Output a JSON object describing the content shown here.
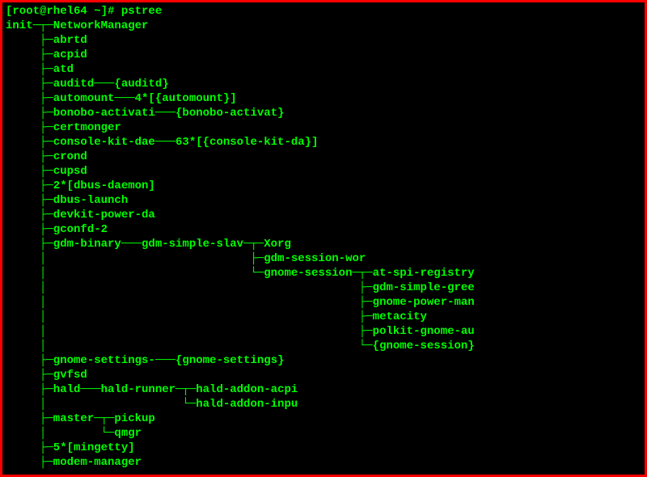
{
  "prompt": "[root@rhel64 ~]# ",
  "command": "pstree",
  "tree": [
    "init─┬─NetworkManager",
    "     ├─abrtd",
    "     ├─acpid",
    "     ├─atd",
    "     ├─auditd───{auditd}",
    "     ├─automount───4*[{automount}]",
    "     ├─bonobo-activati───{bonobo-activat}",
    "     ├─certmonger",
    "     ├─console-kit-dae───63*[{console-kit-da}]",
    "     ├─crond",
    "     ├─cupsd",
    "     ├─2*[dbus-daemon]",
    "     ├─dbus-launch",
    "     ├─devkit-power-da",
    "     ├─gconfd-2",
    "     ├─gdm-binary───gdm-simple-slav─┬─Xorg",
    "     │                              ├─gdm-session-wor",
    "     │                              └─gnome-session─┬─at-spi-registry",
    "     │                                              ├─gdm-simple-gree",
    "     │                                              ├─gnome-power-man",
    "     │                                              ├─metacity",
    "     │                                              ├─polkit-gnome-au",
    "     │                                              └─{gnome-session}",
    "     ├─gnome-settings-───{gnome-settings}",
    "     ├─gvfsd",
    "     ├─hald───hald-runner─┬─hald-addon-acpi",
    "     │                    └─hald-addon-inpu",
    "     ├─master─┬─pickup",
    "     │        └─qmgr",
    "     ├─5*[mingetty]",
    "     ├─modem-manager"
  ]
}
